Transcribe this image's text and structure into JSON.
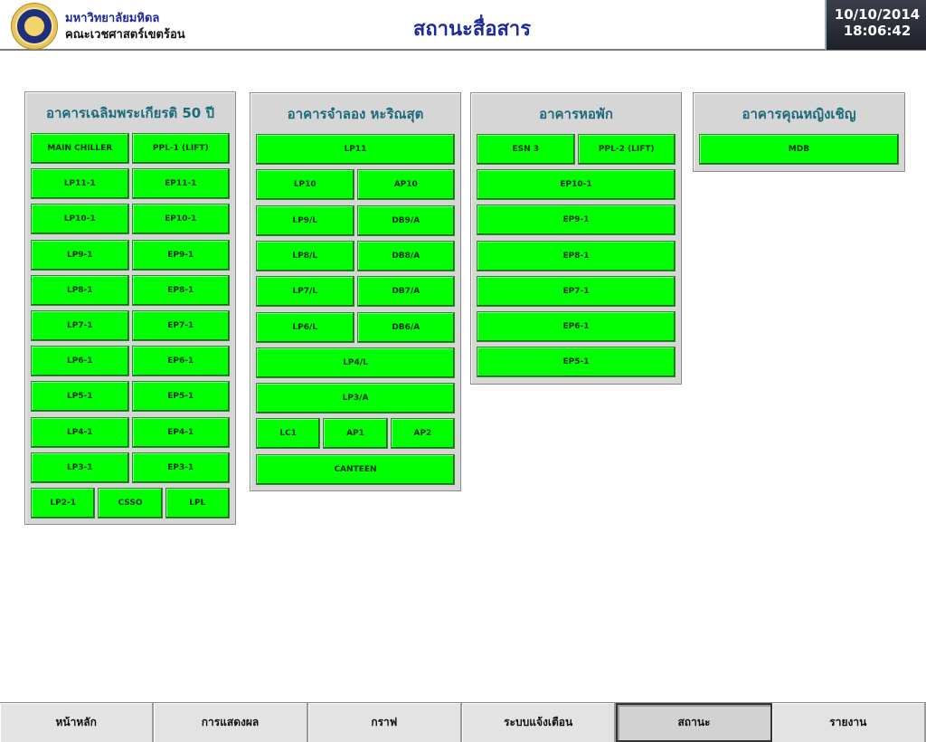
{
  "header": {
    "university": "มหาวิทยาลัยมหิดล",
    "faculty": "คณะเวชศาสตร์เขตร้อน",
    "title": "สถานะสื่อสาร",
    "date": "10/10/2014",
    "time": "18:06:42"
  },
  "panels": [
    {
      "title": "อาคารเฉลิมพระเกียรติ 50 ปี",
      "rows": [
        [
          "MAIN CHILLER",
          "PPL-1 (LIFT)"
        ],
        [
          "LP11-1",
          "EP11-1"
        ],
        [
          "LP10-1",
          "EP10-1"
        ],
        [
          "LP9-1",
          "EP9-1"
        ],
        [
          "LP8-1",
          "EP8-1"
        ],
        [
          "LP7-1",
          "EP7-1"
        ],
        [
          "LP6-1",
          "EP6-1"
        ],
        [
          "LP5-1",
          "EP5-1"
        ],
        [
          "LP4-1",
          "EP4-1"
        ],
        [
          "LP3-1",
          "EP3-1"
        ],
        [
          "LP2-1",
          "CSSO",
          "LPL"
        ]
      ]
    },
    {
      "title": "อาคารจำลอง หะริณสุต",
      "rows": [
        [
          "LP11"
        ],
        [
          "LP10",
          "AP10"
        ],
        [
          "LP9/L",
          "DB9/A"
        ],
        [
          "LP8/L",
          "DB8/A"
        ],
        [
          "LP7/L",
          "DB7/A"
        ],
        [
          "LP6/L",
          "DB6/A"
        ],
        [
          "LP4/L"
        ],
        [
          "LP3/A"
        ],
        [
          "LC1",
          "AP1",
          "AP2"
        ],
        [
          "CANTEEN"
        ]
      ]
    },
    {
      "title": "อาคารหอพัก",
      "rows": [
        [
          "ESN 3",
          "PPL-2 (LIFT)"
        ],
        [
          "EP10-1"
        ],
        [
          "EP9-1"
        ],
        [
          "EP8-1"
        ],
        [
          "EP7-1"
        ],
        [
          "EP6-1"
        ],
        [
          "EP5-1"
        ]
      ]
    },
    {
      "title": "อาคารคุณหญิงเชิญ",
      "rows": [
        [
          "MDB"
        ]
      ]
    }
  ],
  "status_color": "#00ff00",
  "nav": {
    "items": [
      "หน้าหลัก",
      "การแสดงผล",
      "กราฟ",
      "ระบบแจ้งเตือน",
      "สถานะ",
      "รายงาน"
    ],
    "active_index": 4
  }
}
